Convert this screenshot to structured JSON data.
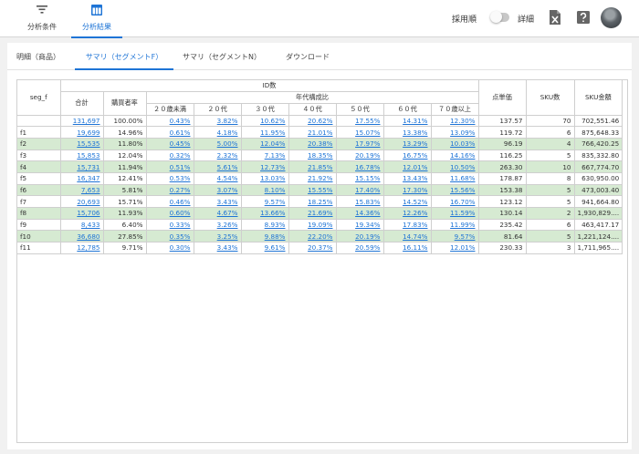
{
  "nav": {
    "tabs": [
      {
        "label": "分析条件",
        "icon": "filter-icon"
      },
      {
        "label": "分析結果",
        "icon": "table-chart-icon"
      }
    ],
    "sort_label": "採用順",
    "detail_label": "詳細",
    "detail_toggle_on": false
  },
  "subtabs": [
    "明細（商品）",
    "サマリ（セグメントF）",
    "サマリ（セグメントN）",
    "ダウンロード"
  ],
  "table": {
    "seg_header": "seg_f",
    "id_group": "ID数",
    "total_header": "合計",
    "rate_header": "購買者率",
    "age_group": "年代構成比",
    "age_headers": [
      "２０歳未満",
      "２０代",
      "３０代",
      "４０代",
      "５０代",
      "６０代",
      "７０歳以上"
    ],
    "price_header": "点単価",
    "sku_count_header": "SKU数",
    "sku_amount_header": "SKU金額",
    "rows": [
      {
        "seg": "",
        "total": "131,697",
        "rate": "100.00%",
        "ages": [
          "0.43%",
          "3.82%",
          "10.62%",
          "20.62%",
          "17.55%",
          "14.31%",
          "12.30%"
        ],
        "price": "137.57",
        "sku": "70",
        "amount": "702,551.46",
        "green": false
      },
      {
        "seg": "f1",
        "total": "19,699",
        "rate": "14.96%",
        "ages": [
          "0.61%",
          "4.18%",
          "11.95%",
          "21.01%",
          "15.07%",
          "13.38%",
          "13.09%"
        ],
        "price": "119.72",
        "sku": "6",
        "amount": "875,648.33",
        "green": false
      },
      {
        "seg": "f2",
        "total": "15,535",
        "rate": "11.80%",
        "ages": [
          "0.45%",
          "5.00%",
          "12.04%",
          "20.38%",
          "17.97%",
          "13.29%",
          "10.03%"
        ],
        "price": "96.19",
        "sku": "4",
        "amount": "766,420.25",
        "green": true
      },
      {
        "seg": "f3",
        "total": "15,853",
        "rate": "12.04%",
        "ages": [
          "0.32%",
          "2.32%",
          "7.13%",
          "18.35%",
          "20.19%",
          "16.75%",
          "14.16%"
        ],
        "price": "116.25",
        "sku": "5",
        "amount": "835,332.80",
        "green": false
      },
      {
        "seg": "f4",
        "total": "15,731",
        "rate": "11.94%",
        "ages": [
          "0.51%",
          "5.61%",
          "12.73%",
          "21.85%",
          "16.78%",
          "12.01%",
          "10.50%"
        ],
        "price": "263.30",
        "sku": "10",
        "amount": "667,774.70",
        "green": true
      },
      {
        "seg": "f5",
        "total": "16,347",
        "rate": "12.41%",
        "ages": [
          "0.53%",
          "4.54%",
          "13.03%",
          "21.92%",
          "15.15%",
          "13.43%",
          "11.68%"
        ],
        "price": "178.87",
        "sku": "8",
        "amount": "630,950.00",
        "green": false
      },
      {
        "seg": "f6",
        "total": "7,653",
        "rate": "5.81%",
        "ages": [
          "0.27%",
          "3.07%",
          "8.10%",
          "15.55%",
          "17.40%",
          "17.30%",
          "15.56%"
        ],
        "price": "153.38",
        "sku": "5",
        "amount": "473,003.40",
        "green": true
      },
      {
        "seg": "f7",
        "total": "20,693",
        "rate": "15.71%",
        "ages": [
          "0.46%",
          "3.43%",
          "9.57%",
          "18.25%",
          "15.83%",
          "14.52%",
          "16.70%"
        ],
        "price": "123.12",
        "sku": "5",
        "amount": "941,664.80",
        "green": false
      },
      {
        "seg": "f8",
        "total": "15,706",
        "rate": "11.93%",
        "ages": [
          "0.60%",
          "4.67%",
          "13.66%",
          "21.69%",
          "14.36%",
          "12.26%",
          "11.59%"
        ],
        "price": "130.14",
        "sku": "2",
        "amount": "1,930,829....",
        "green": true
      },
      {
        "seg": "f9",
        "total": "8,433",
        "rate": "6.40%",
        "ages": [
          "0.33%",
          "3.26%",
          "8.93%",
          "19.09%",
          "19.34%",
          "17.83%",
          "11.99%"
        ],
        "price": "235.42",
        "sku": "6",
        "amount": "463,417.17",
        "green": false
      },
      {
        "seg": "f10",
        "total": "36,680",
        "rate": "27.85%",
        "ages": [
          "0.35%",
          "3.25%",
          "9.88%",
          "22.20%",
          "20.19%",
          "14.74%",
          "9.57%"
        ],
        "price": "81.64",
        "sku": "5",
        "amount": "1,221,124....",
        "green": true
      },
      {
        "seg": "f11",
        "total": "12,785",
        "rate": "9.71%",
        "ages": [
          "0.30%",
          "3.43%",
          "9.61%",
          "20.37%",
          "20.59%",
          "16.11%",
          "12.01%"
        ],
        "price": "230.33",
        "sku": "3",
        "amount": "1,711,965....",
        "green": false
      }
    ]
  }
}
